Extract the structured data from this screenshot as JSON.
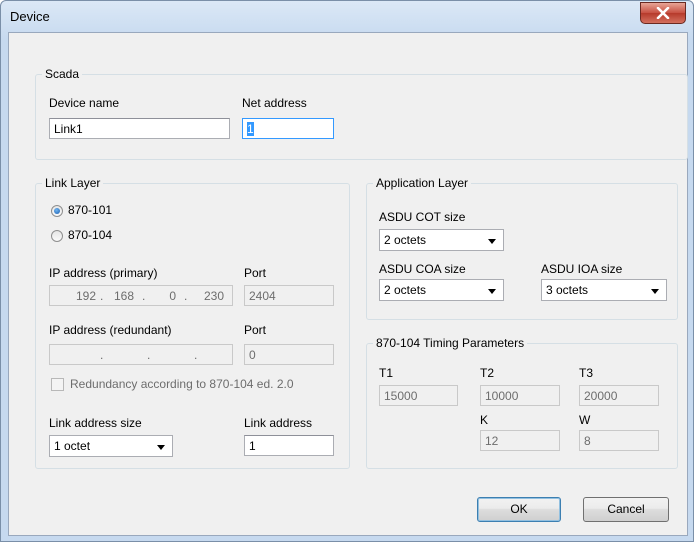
{
  "window": {
    "title": "Device"
  },
  "scada": {
    "group_label": "Scada",
    "device_name_label": "Device name",
    "device_name_value": "Link1",
    "net_address_label": "Net address",
    "net_address_value": "1"
  },
  "link_layer": {
    "group_label": "Link Layer",
    "radio_101": "870-101",
    "radio_104": "870-104",
    "selected": "870-101",
    "ip_primary_label": "IP address (primary)",
    "ip_primary": [
      "192",
      "168",
      "0",
      "230"
    ],
    "port_label": "Port",
    "port_primary": "2404",
    "ip_redundant_label": "IP address (redundant)",
    "ip_redundant": [
      "",
      "",
      "",
      ""
    ],
    "port_redundant_label": "Port",
    "port_redundant": "0",
    "ip_dot": ".",
    "redundancy_label": "Redundancy according to 870-104 ed. 2.0",
    "link_address_size_label": "Link address size",
    "link_address_size_value": "1 octet",
    "link_address_label": "Link address",
    "link_address_value": "1"
  },
  "application_layer": {
    "group_label": "Application Layer",
    "cot_label": "ASDU COT size",
    "cot_value": "2 octets",
    "coa_label": "ASDU COA size",
    "coa_value": "2 octets",
    "ioa_label": "ASDU IOA size",
    "ioa_value": "3 octets"
  },
  "timing": {
    "group_label": "870-104 Timing Parameters",
    "t1_label": "T1",
    "t1_value": "15000",
    "t2_label": "T2",
    "t2_value": "10000",
    "t3_label": "T3",
    "t3_value": "20000",
    "k_label": "K",
    "k_value": "12",
    "w_label": "W",
    "w_value": "8"
  },
  "buttons": {
    "ok": "OK",
    "cancel": "Cancel"
  },
  "colors": {
    "title_bg": "#c6d9ef",
    "close": "#c75042",
    "selection": "#3399ff"
  },
  "icons": {
    "close": "close-icon",
    "dropdown": "chevron-down-icon"
  }
}
